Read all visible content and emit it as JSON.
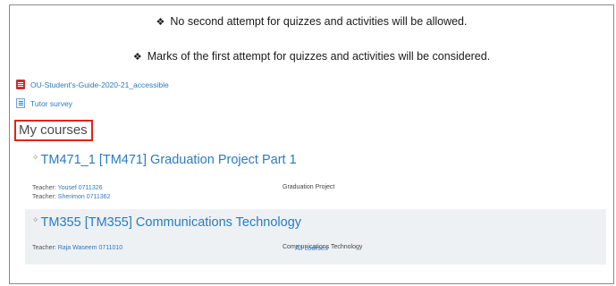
{
  "notices": [
    {
      "bullet": "❖",
      "text": "No second attempt for quizzes and activities will be allowed."
    },
    {
      "bullet": "❖",
      "text": "Marks of  the first attempt for quizzes and activities will be considered."
    }
  ],
  "links": [
    {
      "icon": "pdf-file-icon",
      "label": "OU-Student's-Guide-2020-21_accessible"
    },
    {
      "icon": "survey-icon",
      "label": "Tutor survey"
    }
  ],
  "section_title": "My courses",
  "courses": [
    {
      "icon": "course-icon",
      "title": "TM471_1 [TM471] Graduation Project Part 1",
      "teachers": [
        {
          "role": "Teacher: ",
          "name": "Yousef 0711326"
        },
        {
          "role": "Teacher: ",
          "name": "Sherimon 0711362"
        }
      ],
      "summary": "Graduation Project"
    },
    {
      "icon": "course-icon",
      "title": "TM355 [TM355] Communications Technology",
      "teachers": [
        {
          "role": "Teacher: ",
          "name": "Raja Waseem 0711010"
        }
      ],
      "summary": "Communications Technology"
    }
  ],
  "all_courses_label": "All courses",
  "colors": {
    "link": "#2b7bc0",
    "highlight_border": "#e2231a",
    "course_alt_bg": "#eef1f4"
  }
}
